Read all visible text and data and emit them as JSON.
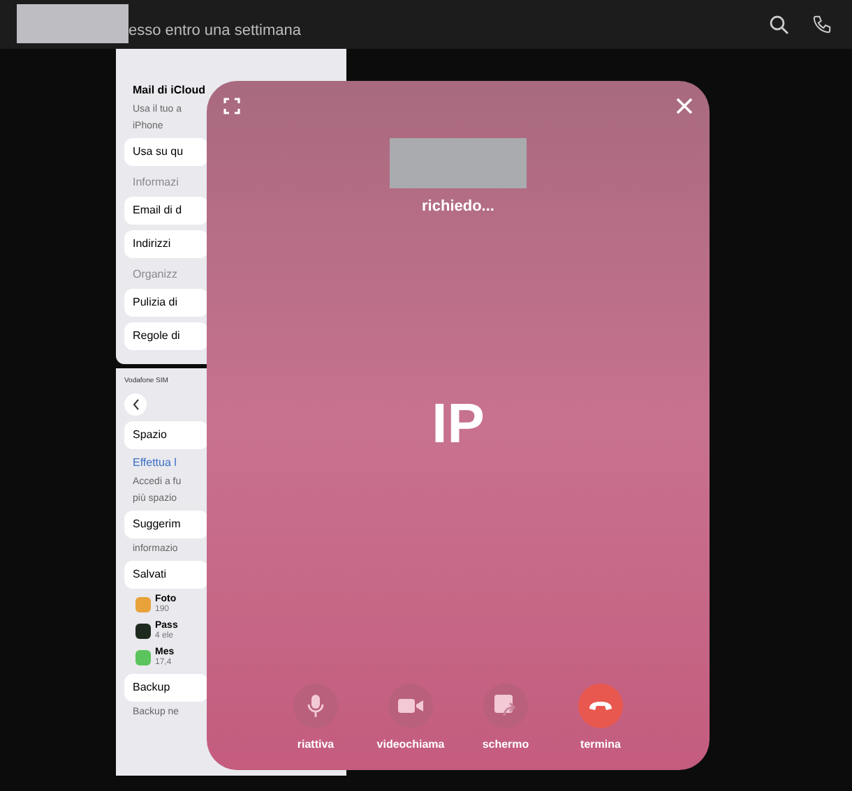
{
  "header": {
    "subtitle": "esso entro una settimana"
  },
  "shared_images": [
    {
      "lines": [
        {
          "kind": "title",
          "text": "Mail di iCloud"
        },
        {
          "kind": "text",
          "text": "Usa il tuo a"
        },
        {
          "kind": "text",
          "text": "iPhone"
        },
        {
          "kind": "card",
          "text": "Usa su qu"
        },
        {
          "kind": "section",
          "text": "Informazi"
        },
        {
          "kind": "card",
          "text": "Email di d"
        },
        {
          "kind": "card",
          "text": "Indirizzi"
        },
        {
          "kind": "section",
          "text": "Organizz"
        },
        {
          "kind": "card",
          "text": "Pulizia di"
        },
        {
          "kind": "card",
          "text": "Regole di"
        }
      ]
    },
    {
      "lines": [
        {
          "kind": "status",
          "text": "Vodafone SIM"
        },
        {
          "kind": "back"
        },
        {
          "kind": "card",
          "text": "Spazio"
        },
        {
          "kind": "link",
          "text": "Effettua l"
        },
        {
          "kind": "text",
          "text": "Accedi a fu"
        },
        {
          "kind": "text",
          "text": "più spazio"
        },
        {
          "kind": "card",
          "text": "Suggerim"
        },
        {
          "kind": "text",
          "text": "informazio"
        },
        {
          "kind": "card",
          "text": "Salvati"
        },
        {
          "kind": "app",
          "text": "Foto",
          "detail": "190",
          "color": "#e8a23a"
        },
        {
          "kind": "app",
          "text": "Pass",
          "detail": "4 ele",
          "color": "#1f2a1f"
        },
        {
          "kind": "app",
          "text": "Mes",
          "detail": "17,4",
          "color": "#5cc45c"
        },
        {
          "kind": "card",
          "text": "Backup"
        },
        {
          "kind": "text",
          "text": "Backup ne"
        }
      ]
    }
  ],
  "call": {
    "status": "richiedo...",
    "initials": "IP",
    "controls": [
      {
        "kind": "mic",
        "label": "riattiva"
      },
      {
        "kind": "video",
        "label": "videochiama"
      },
      {
        "kind": "screen",
        "label": "schermo"
      },
      {
        "kind": "end",
        "label": "termina"
      }
    ]
  }
}
